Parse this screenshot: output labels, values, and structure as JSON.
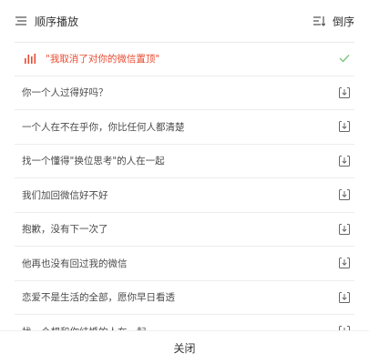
{
  "header": {
    "mode_label": "顺序播放",
    "sort_label": "倒序"
  },
  "playlist": {
    "items": [
      {
        "title": "\"我取消了对你的微信置顶\"",
        "playing": true
      },
      {
        "title": "你一个人过得好吗？",
        "playing": false
      },
      {
        "title": "一个人在不在乎你，你比任何人都清楚",
        "playing": false
      },
      {
        "title": "找一个懂得\"换位思考\"的人在一起",
        "playing": false
      },
      {
        "title": "我们加回微信好不好",
        "playing": false
      },
      {
        "title": "抱歉，没有下一次了",
        "playing": false
      },
      {
        "title": "他再也没有回过我的微信",
        "playing": false
      },
      {
        "title": "恋爱不是生活的全部，愿你早日看透",
        "playing": false
      },
      {
        "title": "找一个想和你结婚的人在一起",
        "playing": false
      }
    ]
  },
  "footer": {
    "close_label": "关闭"
  },
  "colors": {
    "accent": "#e84a2f",
    "check": "#7cc47f",
    "icon": "#666666"
  },
  "icons": {
    "mode": "sequential-list-icon",
    "sort": "sort-icon",
    "playing": "equalizer-icon",
    "current": "checkmark-icon",
    "row_action": "download-icon"
  }
}
